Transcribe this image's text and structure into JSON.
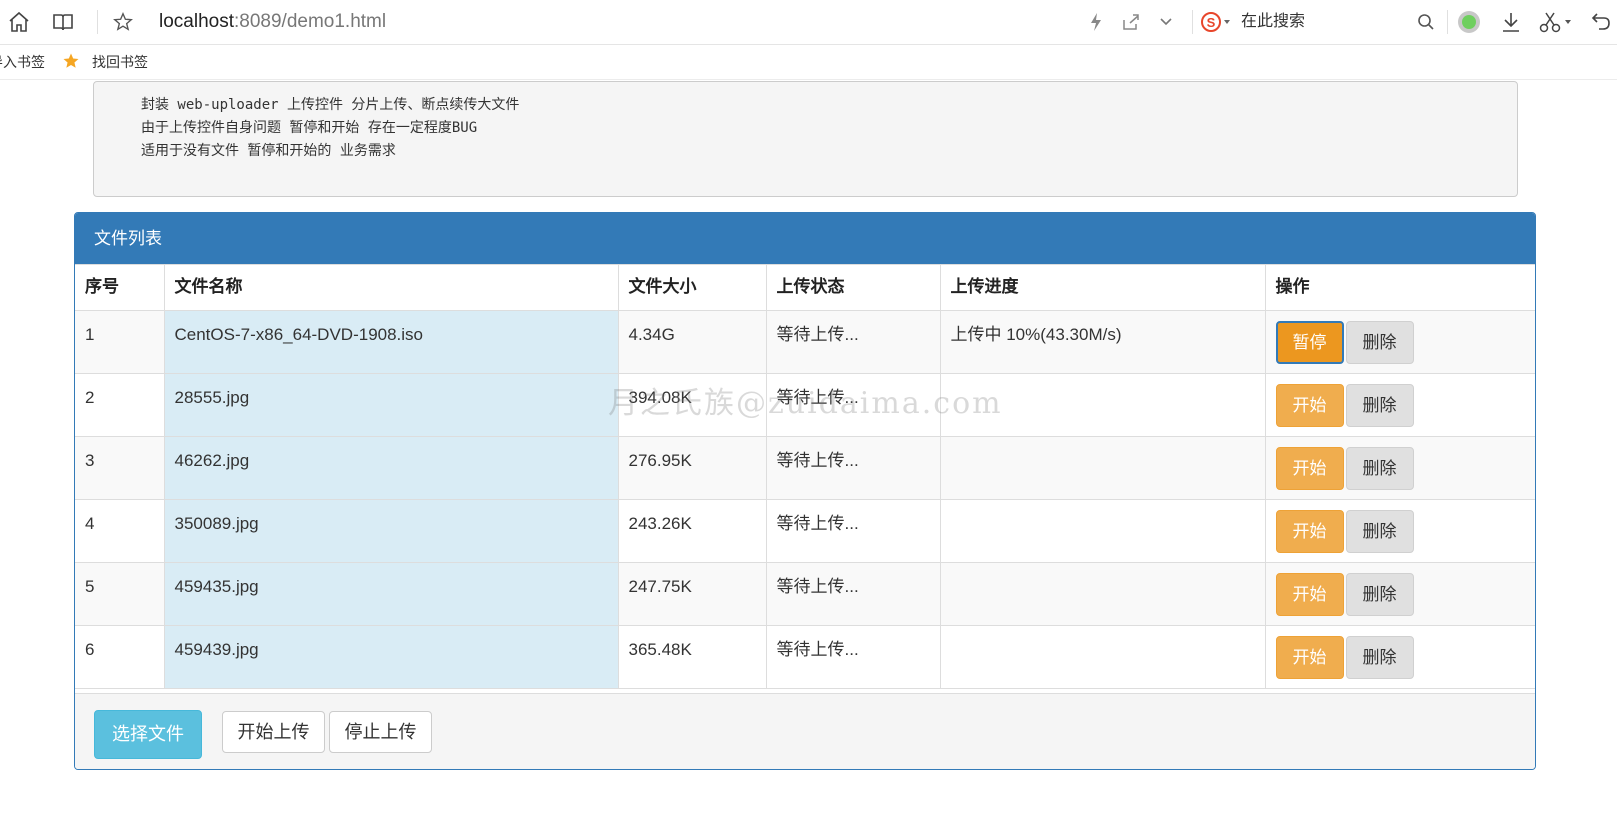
{
  "browser": {
    "url_host": "localhost",
    "url_rest": ":8089/demo1.html",
    "search_placeholder": "在此搜索",
    "icons": [
      "home-icon",
      "reader-icon",
      "star-icon",
      "lightning-icon",
      "share-icon",
      "chevron-down-icon",
      "sogou-icon",
      "search-icon",
      "extension-icon",
      "download-icon",
      "scissors-icon",
      "undo-icon"
    ]
  },
  "bookmarks": {
    "import_label": "导入书签",
    "recover_label": "找回书签"
  },
  "notes": {
    "lines": [
      "封装 web-uploader 上传控件 分片上传、断点续传大文件",
      "由于上传控件自身问题 暂停和开始 存在一定程度BUG",
      "适用于没有文件 暂停和开始的 业务需求"
    ]
  },
  "panel": {
    "title": "文件列表",
    "columns": [
      "序号",
      "文件名称",
      "文件大小",
      "上传状态",
      "上传进度",
      "操作"
    ],
    "rows": [
      {
        "index": "1",
        "name": "CentOS-7-x86_64-DVD-1908.iso",
        "size": "4.34G",
        "status": "等待上传...",
        "progress": "上传中 10%(43.30M/s)",
        "action": "暂停",
        "delete": "删除"
      },
      {
        "index": "2",
        "name": "28555.jpg",
        "size": "394.08K",
        "status": "等待上传...",
        "progress": "",
        "action": "开始",
        "delete": "删除"
      },
      {
        "index": "3",
        "name": "46262.jpg",
        "size": "276.95K",
        "status": "等待上传...",
        "progress": "",
        "action": "开始",
        "delete": "删除"
      },
      {
        "index": "4",
        "name": "350089.jpg",
        "size": "243.26K",
        "status": "等待上传...",
        "progress": "",
        "action": "开始",
        "delete": "删除"
      },
      {
        "index": "5",
        "name": "459435.jpg",
        "size": "247.75K",
        "status": "等待上传...",
        "progress": "",
        "action": "开始",
        "delete": "删除"
      },
      {
        "index": "6",
        "name": "459439.jpg",
        "size": "365.48K",
        "status": "等待上传...",
        "progress": "",
        "action": "开始",
        "delete": "删除"
      }
    ],
    "footer": {
      "choose_label": "选择文件",
      "start_label": "开始上传",
      "stop_label": "停止上传"
    }
  },
  "watermark": "月之氏族@zuidaima.com",
  "colors": {
    "primary": "#337ab7",
    "warning": "#f0ad4e",
    "info": "#5bc0de",
    "name_cell": "#d9ecf5"
  }
}
